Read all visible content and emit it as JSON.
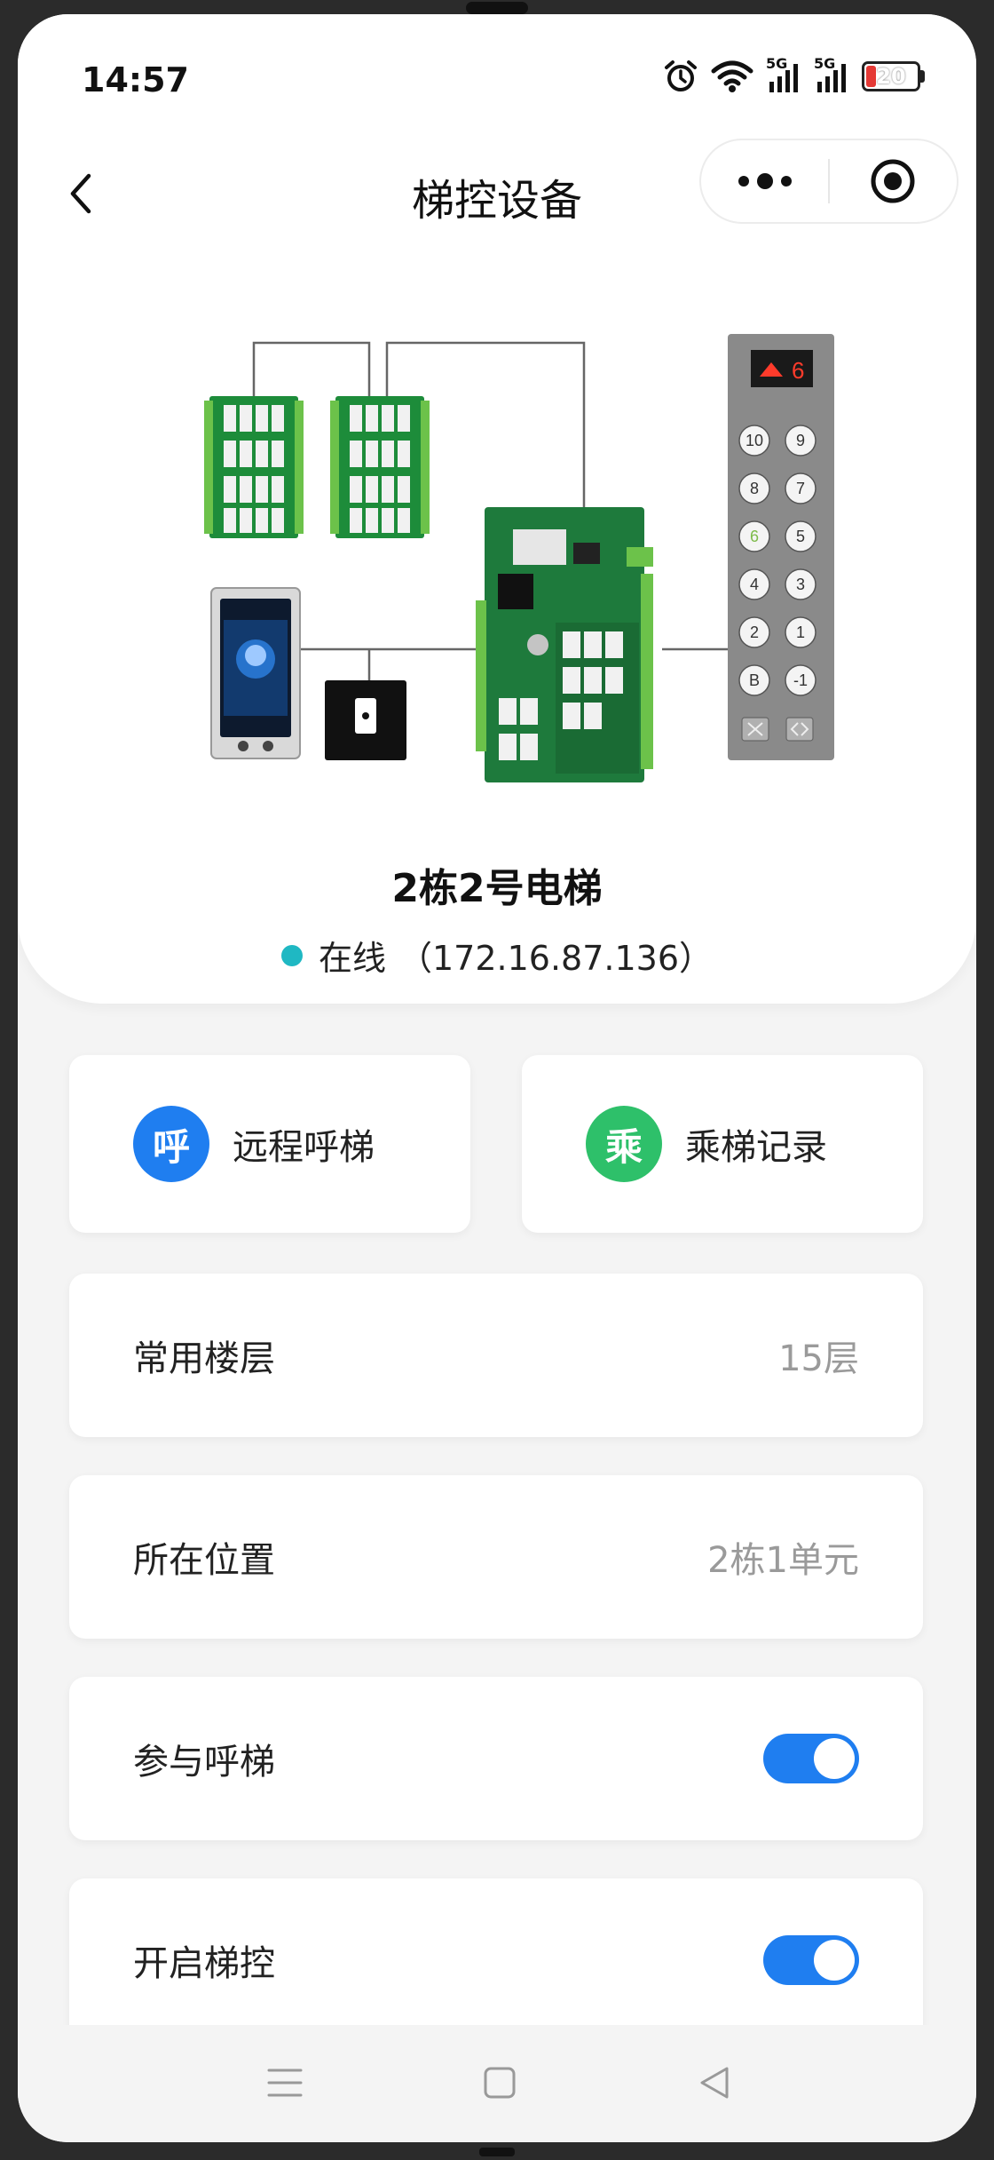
{
  "status_bar": {
    "time": "14:57",
    "network_1": "5G",
    "network_2": "5G",
    "battery": "20"
  },
  "nav": {
    "title": "梯控设备"
  },
  "device": {
    "name": "2栋2号电梯",
    "status": "在线",
    "ip": "（172.16.87.136）",
    "panel_display": "6",
    "panel_buttons": [
      "10",
      "9",
      "8",
      "7",
      "6",
      "5",
      "4",
      "3",
      "2",
      "1",
      "B",
      "-1"
    ]
  },
  "actions": [
    {
      "icon_text": "呼",
      "label": "远程呼梯",
      "color": "#1f7ef0"
    },
    {
      "icon_text": "乘",
      "label": "乘梯记录",
      "color": "#2ec06a"
    }
  ],
  "settings": {
    "common_floor": {
      "label": "常用楼层",
      "value": "15层"
    },
    "location": {
      "label": "所在位置",
      "value": "2栋1单元"
    },
    "join_call": {
      "label": "参与呼梯",
      "enabled": true
    },
    "enable_control": {
      "label": "开启梯控",
      "enabled": true
    }
  },
  "colors": {
    "accent": "#1f7ef0",
    "online": "#1fb8c3",
    "record": "#2ec06a"
  }
}
